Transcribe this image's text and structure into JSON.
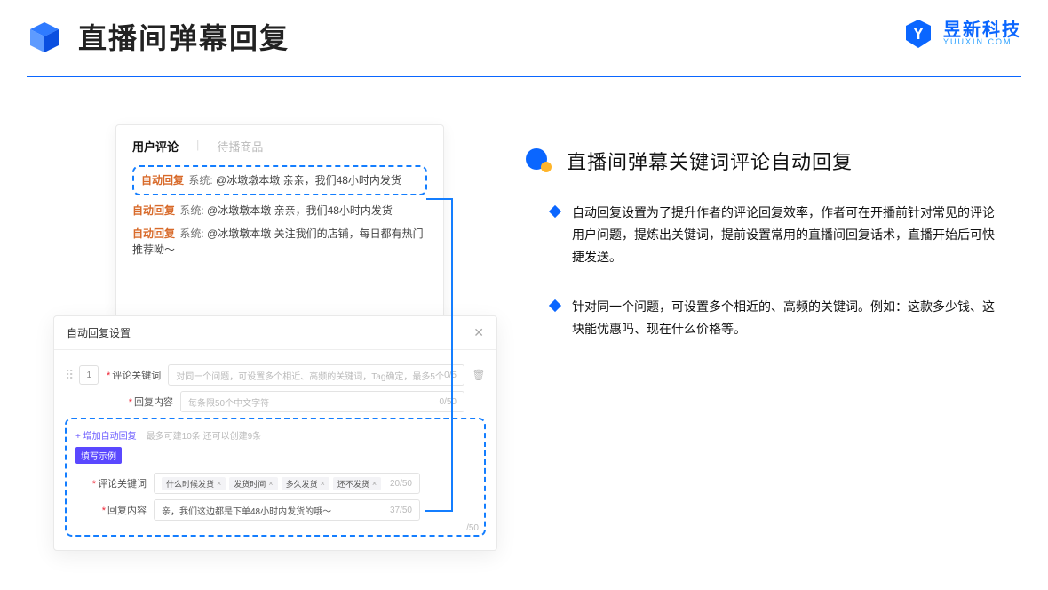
{
  "header": {
    "title": "直播间弹幕回复",
    "brand_name": "昱新科技",
    "brand_sub": "YUUXIN.COM"
  },
  "comments_panel": {
    "tab_active": "用户评论",
    "tab_inactive": "待播商品",
    "auto_tag": "自动回复",
    "sys_label": "系统:",
    "line1_text": "@冰墩墩本墩 亲亲，我们48小时内发货",
    "line2_text": "@冰墩墩本墩 亲亲，我们48小时内发货",
    "line3_text": "@冰墩墩本墩 关注我们的店铺，每日都有热门推荐呦～"
  },
  "settings_panel": {
    "title": "自动回复设置",
    "index": "1",
    "kw_label": "评论关键词",
    "kw_placeholder": "对同一个问题，可设置多个相近、高频的关键词，Tag确定，最多5个",
    "kw_counter": "0/5",
    "reply_label": "回复内容",
    "reply_placeholder": "每条限50个中文字符",
    "reply_counter": "0/50",
    "add_link": "+ 增加自动回复",
    "add_hint": "最多可建10条 还可以创建9条",
    "example_chip": "填写示例",
    "ex_kw_label": "评论关键词",
    "ex_tags": [
      "什么时候发货",
      "发货时间",
      "多久发货",
      "还不发货"
    ],
    "ex_kw_counter": "20/50",
    "ex_reply_label": "回复内容",
    "ex_reply_text": "亲，我们这边都是下单48小时内发货的哦～",
    "ex_reply_counter": "37/50",
    "stray_counter": "/50"
  },
  "right": {
    "section_title": "直播间弹幕关键词评论自动回复",
    "bullet1": "自动回复设置为了提升作者的评论回复效率，作者可在开播前针对常见的评论用户问题，提炼出关键词，提前设置常用的直播间回复话术，直播开始后可快捷发送。",
    "bullet2": "针对同一个问题，可设置多个相近的、高频的关键词。例如：这款多少钱、这块能优惠吗、现在什么价格等。"
  }
}
